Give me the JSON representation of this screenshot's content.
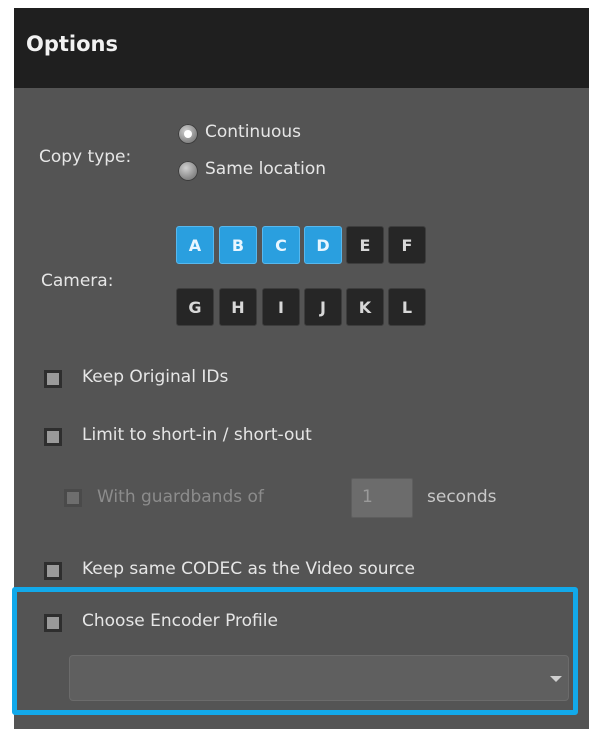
{
  "header": {
    "title": "Options"
  },
  "copy_type": {
    "label": "Copy type:",
    "options": [
      {
        "label": "Continuous",
        "checked": true
      },
      {
        "label": "Same location",
        "checked": false
      }
    ]
  },
  "camera": {
    "label": "Camera:",
    "buttons": [
      {
        "label": "A",
        "selected": true
      },
      {
        "label": "B",
        "selected": true
      },
      {
        "label": "C",
        "selected": true
      },
      {
        "label": "D",
        "selected": true
      },
      {
        "label": "E",
        "selected": false
      },
      {
        "label": "F",
        "selected": false
      },
      {
        "label": "G",
        "selected": false
      },
      {
        "label": "H",
        "selected": false
      },
      {
        "label": "I",
        "selected": false
      },
      {
        "label": "J",
        "selected": false
      },
      {
        "label": "K",
        "selected": false
      },
      {
        "label": "L",
        "selected": false
      }
    ]
  },
  "options": {
    "keep_ids": {
      "label": "Keep Original IDs",
      "checked": false
    },
    "limit_short": {
      "label": "Limit to short-in / short-out",
      "checked": false
    },
    "guardbands": {
      "prefix": "With guardbands of",
      "value": "1",
      "suffix": "seconds",
      "enabled": false
    },
    "keep_codec": {
      "label": "Keep same CODEC as the Video source",
      "checked": false
    },
    "encoder_profile": {
      "label": "Choose Encoder Profile",
      "checked": false,
      "selected_value": ""
    }
  },
  "colors": {
    "accent": "#2a9fdf",
    "highlight": "#12a9ea",
    "panel": "#545454",
    "header": "#1f1f1f"
  }
}
